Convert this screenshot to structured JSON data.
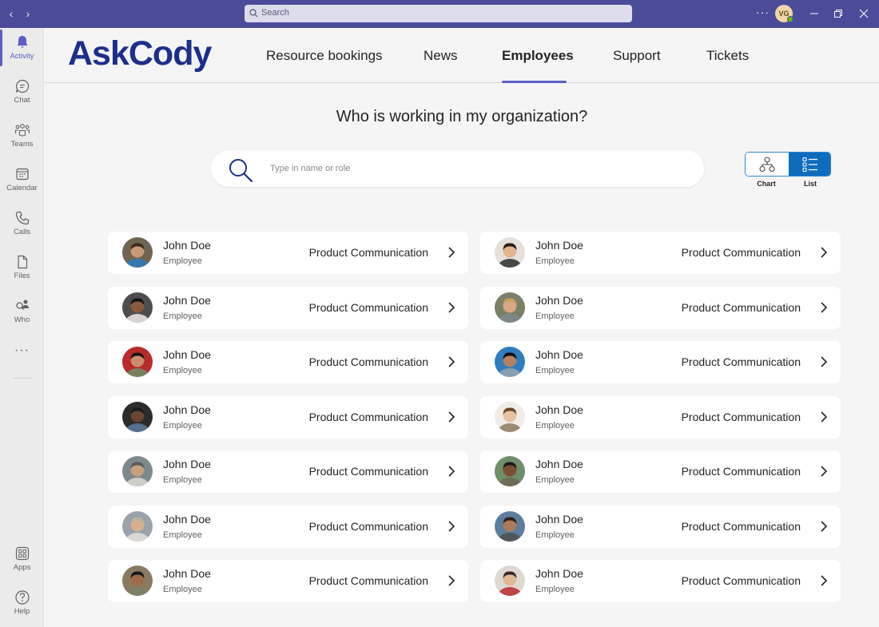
{
  "titlebar": {
    "search_placeholder": "Search",
    "more": "···",
    "avatar_initials": "VG"
  },
  "rail": {
    "items": [
      {
        "label": "Activity",
        "icon": "bell-icon"
      },
      {
        "label": "Chat",
        "icon": "chat-icon"
      },
      {
        "label": "Teams",
        "icon": "teams-icon"
      },
      {
        "label": "Calendar",
        "icon": "calendar-icon"
      },
      {
        "label": "Calls",
        "icon": "phone-icon"
      },
      {
        "label": "Files",
        "icon": "file-icon"
      },
      {
        "label": "Who",
        "icon": "who-icon"
      }
    ],
    "more": "···",
    "bottom": [
      {
        "label": "Apps",
        "icon": "apps-icon"
      },
      {
        "label": "Help",
        "icon": "help-icon"
      }
    ]
  },
  "app": {
    "logo": "AskCody",
    "tabs": [
      "Resource bookings",
      "News",
      "Employees",
      "Support",
      "Tickets"
    ],
    "active_tab": "Employees"
  },
  "main": {
    "question": "Who is working in my organization?",
    "search_placeholder": "Type in name or role",
    "view_toggle": {
      "chart_label": "Chart",
      "list_label": "List",
      "selected": "List"
    }
  },
  "employees": [
    {
      "name": "John Doe",
      "role": "Employee",
      "department": "Product Communication"
    },
    {
      "name": "John Doe",
      "role": "Employee",
      "department": "Product Communication"
    },
    {
      "name": "John Doe",
      "role": "Employee",
      "department": "Product Communication"
    },
    {
      "name": "John Doe",
      "role": "Employee",
      "department": "Product Communication"
    },
    {
      "name": "John Doe",
      "role": "Employee",
      "department": "Product Communication"
    },
    {
      "name": "John Doe",
      "role": "Employee",
      "department": "Product Communication"
    },
    {
      "name": "John Doe",
      "role": "Employee",
      "department": "Product Communication"
    },
    {
      "name": "John Doe",
      "role": "Employee",
      "department": "Product Communication"
    },
    {
      "name": "John Doe",
      "role": "Employee",
      "department": "Product Communication"
    },
    {
      "name": "John Doe",
      "role": "Employee",
      "department": "Product Communication"
    },
    {
      "name": "John Doe",
      "role": "Employee",
      "department": "Product Communication"
    },
    {
      "name": "John Doe",
      "role": "Employee",
      "department": "Product Communication"
    },
    {
      "name": "John Doe",
      "role": "Employee",
      "department": "Product Communication"
    },
    {
      "name": "John Doe",
      "role": "Employee",
      "department": "Product Communication"
    }
  ],
  "colors": {
    "titlebar": "#4b4c99",
    "accent": "#5b5fc7",
    "logo": "#1d2f8c",
    "toggle_selected": "#0f6cbd"
  }
}
